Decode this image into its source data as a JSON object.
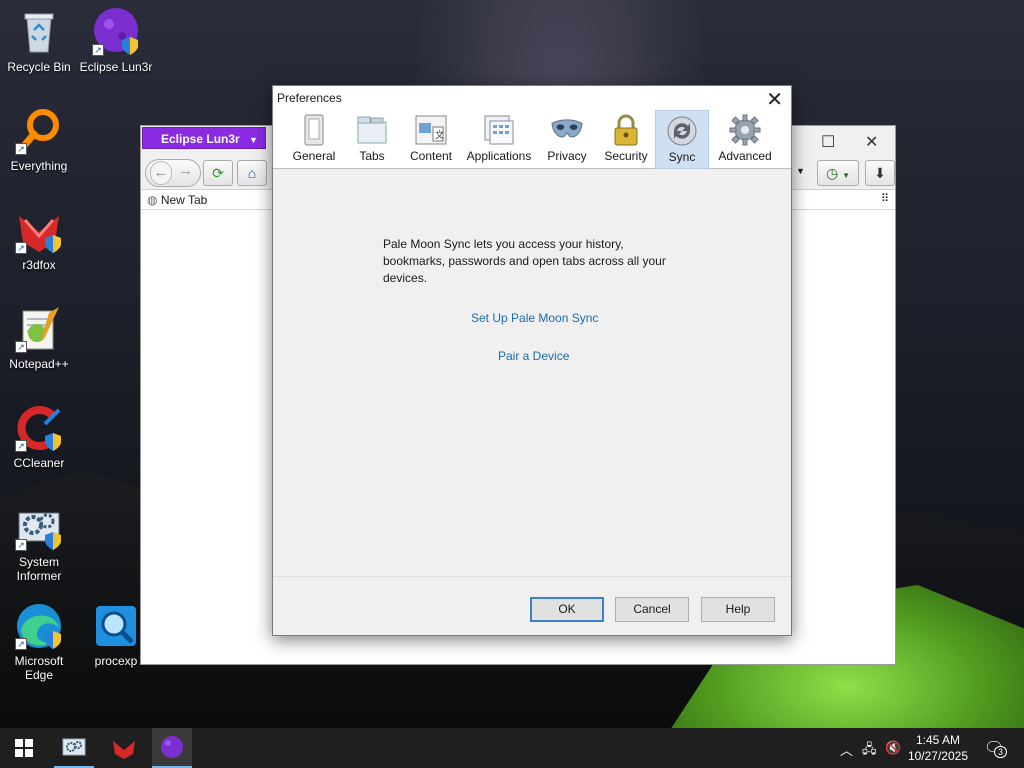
{
  "desktop": {
    "icons": [
      {
        "label": "Recycle Bin"
      },
      {
        "label": "Eclipse Lun3r"
      },
      {
        "label": "Everything"
      },
      {
        "label": "r3dfox"
      },
      {
        "label": "Notepad++"
      },
      {
        "label": "CCleaner"
      },
      {
        "label": "System Informer"
      },
      {
        "label": "Microsoft Edge"
      },
      {
        "label": "procexp"
      }
    ]
  },
  "browser": {
    "menu_button": "Eclipse Lun3r",
    "tab_title": "New Tab"
  },
  "dialog": {
    "title": "Preferences",
    "panes": [
      {
        "label": "General",
        "icon": "general-icon"
      },
      {
        "label": "Tabs",
        "icon": "tabs-icon"
      },
      {
        "label": "Content",
        "icon": "content-icon"
      },
      {
        "label": "Applications",
        "icon": "applications-icon"
      },
      {
        "label": "Privacy",
        "icon": "privacy-mask-icon"
      },
      {
        "label": "Security",
        "icon": "padlock-icon"
      },
      {
        "label": "Sync",
        "icon": "sync-icon",
        "selected": true
      },
      {
        "label": "Advanced",
        "icon": "gear-icon"
      }
    ],
    "sync_description": "Pale Moon Sync lets you access your history, bookmarks, passwords and open tabs across all your devices.",
    "setup_link": "Set Up Pale Moon Sync",
    "pair_link": "Pair a Device",
    "buttons": {
      "ok": "OK",
      "cancel": "Cancel",
      "help": "Help"
    }
  },
  "taskbar": {
    "time": "1:45 AM",
    "date": "10/27/2025",
    "notification_count": "3"
  },
  "colors": {
    "accent": "#8a2be2",
    "link": "#1a6bb0",
    "selected_pane": "#cfe0f2"
  }
}
